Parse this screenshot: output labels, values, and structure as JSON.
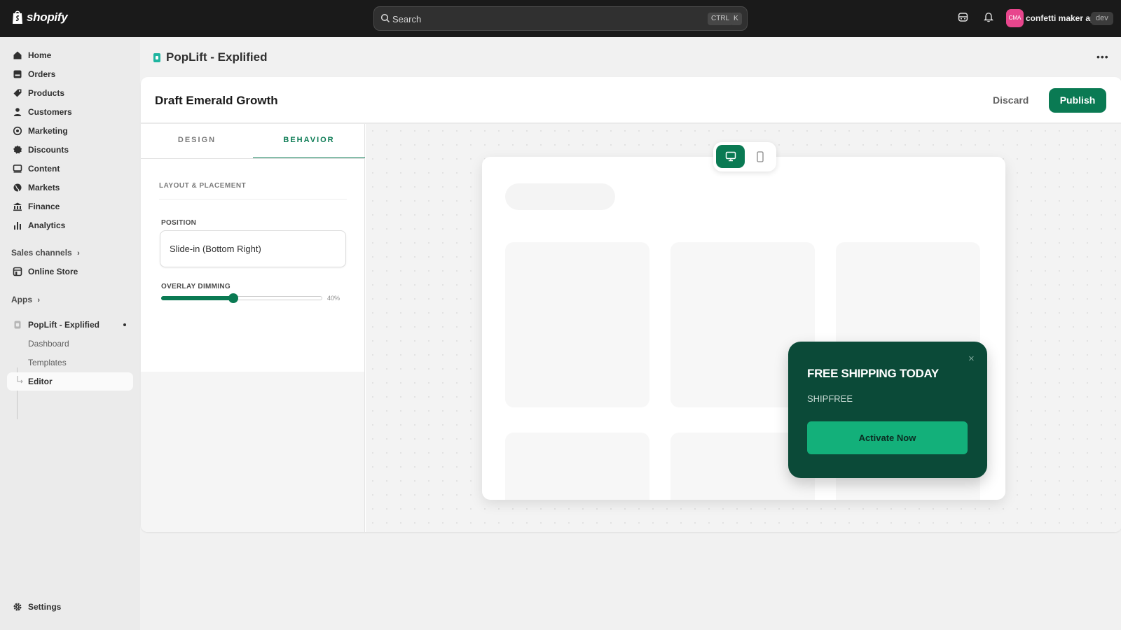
{
  "topbar": {
    "logo_text": "shopify",
    "search_placeholder": "Search",
    "shortcut_ctrl": "CTRL",
    "shortcut_key": "K",
    "store_initials": "CMA",
    "store_name": "confetti maker app",
    "env_badge": "dev"
  },
  "sidebar": {
    "items": [
      {
        "label": "Home",
        "icon": "home-icon"
      },
      {
        "label": "Orders",
        "icon": "orders-icon"
      },
      {
        "label": "Products",
        "icon": "tag-icon"
      },
      {
        "label": "Customers",
        "icon": "person-icon"
      },
      {
        "label": "Marketing",
        "icon": "target-icon"
      },
      {
        "label": "Discounts",
        "icon": "discount-icon"
      },
      {
        "label": "Content",
        "icon": "content-icon"
      },
      {
        "label": "Markets",
        "icon": "globe-icon"
      },
      {
        "label": "Finance",
        "icon": "bank-icon"
      },
      {
        "label": "Analytics",
        "icon": "bar-chart-icon"
      }
    ],
    "sales_channels_label": "Sales channels",
    "online_store_label": "Online Store",
    "apps_label": "Apps",
    "app_name": "PopLift - Explified",
    "app_subitems": [
      "Dashboard",
      "Templates",
      "Editor"
    ],
    "settings_label": "Settings"
  },
  "main": {
    "app_title": "PopLift - Explified",
    "draft_title": "Draft Emerald Growth",
    "discard_label": "Discard",
    "publish_label": "Publish",
    "tabs": [
      "DESIGN",
      "BEHAVIOR"
    ],
    "active_tab": "BEHAVIOR",
    "section_title": "LAYOUT & PLACEMENT",
    "position_label": "POSITION",
    "position_value": "Slide-in (Bottom Right)",
    "overlay_label": "OVERLAY DIMMING",
    "overlay_value": "40%",
    "overlay_fraction": 0.4
  },
  "popup": {
    "title": "FREE SHIPPING TODAY",
    "code": "SHIPFREE",
    "cta_label": "Activate Now",
    "close_glyph": "×",
    "bg_color": "#0b4a38",
    "cta_color": "#13b07a"
  },
  "colors": {
    "accent": "#0a7a53",
    "topbar": "#1a1a1a"
  }
}
